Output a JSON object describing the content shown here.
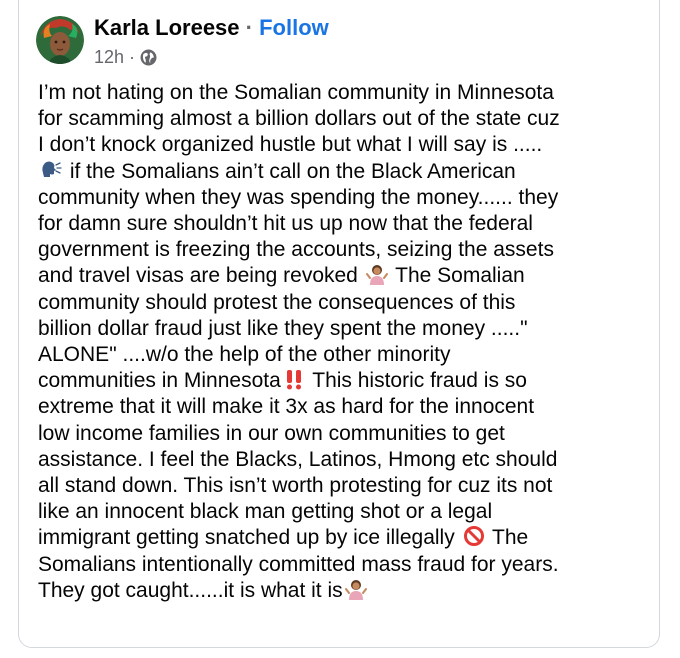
{
  "post": {
    "author": "Karla Loreese",
    "separator": "·",
    "follow_label": "Follow",
    "timestamp": "12h",
    "meta_separator": "·",
    "audience_icon": "globe-icon",
    "emoji_icons": [
      "speaking-head-icon",
      "shrugging-woman-icon",
      "double-exclamation-icon",
      "prohibited-icon"
    ],
    "lines": [
      [
        "I’m not hating on the Somalian community in Minnesota"
      ],
      [
        "for scamming almost a billion dollars out of the state cuz"
      ],
      [
        "I don’t knock organized hustle but what I will say is ....."
      ],
      [
        " if the Somalians ain’t call on the Black American"
      ],
      [
        "community when they was spending the money...... they"
      ],
      [
        "for damn sure shouldn’t hit us up now that the federal"
      ],
      [
        "government is freezing the  accounts, seizing the assets"
      ],
      [
        "and travel visas are being revoked ",
        " The Somalian"
      ],
      [
        "community should  protest the consequences of this"
      ],
      [
        "billion dollar fraud just like they spent the money .....\""
      ],
      [
        "ALONE\" ....w/o the help of the other minority"
      ],
      [
        "communities in Minnesota",
        " This historic fraud is so"
      ],
      [
        "extreme that it will make it 3x as hard for the innocent"
      ],
      [
        "low income families in our own communities to get"
      ],
      [
        "assistance. I feel the Blacks, Latinos, Hmong  etc should"
      ],
      [
        "all stand down. This isn’t worth protesting for cuz its not"
      ],
      [
        "like an innocent black man getting shot or a legal"
      ],
      [
        "immigrant getting snatched up by ice illegally ",
        " The"
      ],
      [
        "Somalians intentionally committed mass fraud for years."
      ],
      [
        "They got caught......it is what it is"
      ]
    ]
  }
}
